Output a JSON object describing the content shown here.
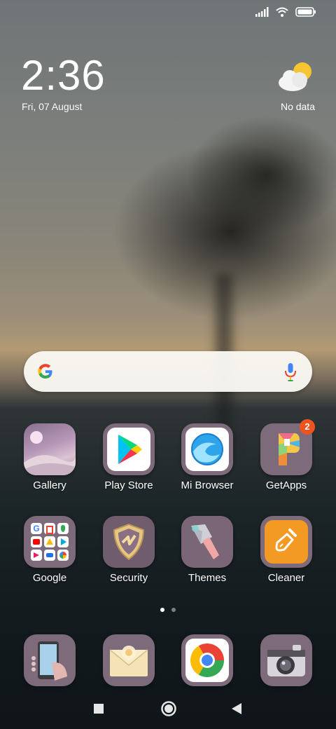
{
  "status_bar": {
    "signal_icon": "signal-bars-icon",
    "wifi_icon": "wifi-icon",
    "battery_icon": "battery-icon"
  },
  "clock": {
    "time": "2:36",
    "date": "Fri, 07 August"
  },
  "weather": {
    "icon": "partly-cloudy-icon",
    "text": "No data"
  },
  "search_bar": {
    "logo_icon": "google-g-icon",
    "mic_icon": "mic-icon"
  },
  "apps": [
    {
      "label": "Gallery",
      "icon": "gallery-icon"
    },
    {
      "label": "Play Store",
      "icon": "play-store-icon"
    },
    {
      "label": "Mi Browser",
      "icon": "mi-browser-icon"
    },
    {
      "label": "GetApps",
      "icon": "getapps-icon",
      "badge": "2"
    },
    {
      "label": "Google",
      "icon": "google-folder-icon"
    },
    {
      "label": "Security",
      "icon": "security-icon"
    },
    {
      "label": "Themes",
      "icon": "themes-icon"
    },
    {
      "label": "Cleaner",
      "icon": "cleaner-icon"
    }
  ],
  "dock": [
    {
      "icon": "phone-icon"
    },
    {
      "icon": "messages-icon"
    },
    {
      "icon": "chrome-icon"
    },
    {
      "icon": "camera-icon"
    }
  ],
  "page_indicator": {
    "pages": 2,
    "current": 1
  },
  "nav_bar": {
    "recents_icon": "recents-square-icon",
    "home_icon": "home-circle-icon",
    "back_icon": "back-triangle-icon"
  },
  "colors": {
    "badge": "#f0541e",
    "icon_tile": "#7d6a7a",
    "search_bg": "#faf8f3"
  }
}
